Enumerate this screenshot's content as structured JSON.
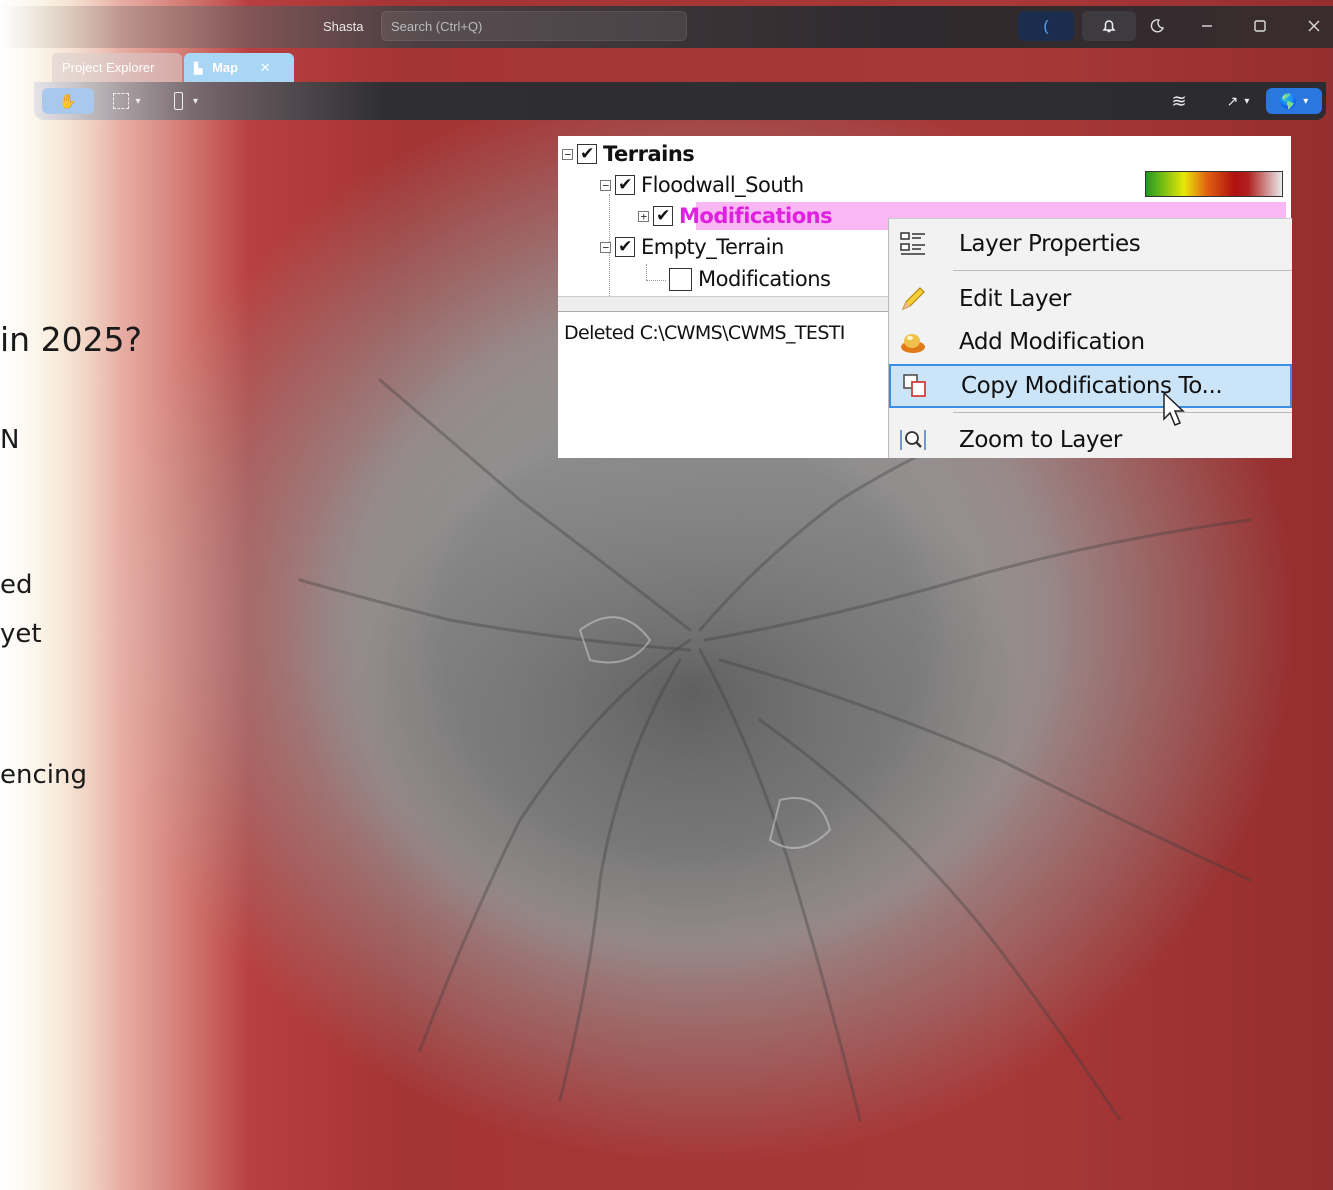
{
  "app": {
    "name": "Shasta",
    "search_placeholder": "Search (Ctrl+Q)"
  },
  "window_controls": [
    "minimize-icon",
    "maximize-icon",
    "close-icon"
  ],
  "tabs": [
    {
      "label": "Project Explorer",
      "active": false
    },
    {
      "label": "Map",
      "active": true
    }
  ],
  "slide_text": {
    "line1": "in 2025?",
    "line2": "N",
    "line3": "ed",
    "line4": "yet",
    "line5": "encing"
  },
  "tree": {
    "items": [
      {
        "label": "Terrains",
        "checked": true,
        "bold": true
      },
      {
        "label": "Floodwall_South",
        "checked": true
      },
      {
        "label": "Modifications",
        "checked": true,
        "highlighted": true
      },
      {
        "label": "Empty_Terrain",
        "checked": true
      },
      {
        "label": "Modifications",
        "checked": false
      }
    ],
    "log_text": "Deleted C:\\CWMS\\CWMS_TESTI",
    "ramp_colors": [
      "#1f9a1f",
      "#e8e80a",
      "#e06010",
      "#b01010",
      "#eaeaea"
    ]
  },
  "context_menu": {
    "items": [
      {
        "label": "Layer Properties",
        "icon": "properties-icon"
      },
      {
        "label": "Edit Layer",
        "icon": "pencil-icon"
      },
      {
        "label": "Add Modification",
        "icon": "add-modification-icon"
      },
      {
        "label": "Copy Modifications To...",
        "icon": "copy-icon",
        "highlighted": true
      },
      {
        "label": "Zoom to Layer",
        "icon": "zoom-icon"
      }
    ]
  },
  "colors": {
    "accent": "#2a77e0",
    "menu_highlight": "#cce4f7",
    "tree_highlight": "#f9b7f3",
    "highlight_text": "#e020e0"
  }
}
